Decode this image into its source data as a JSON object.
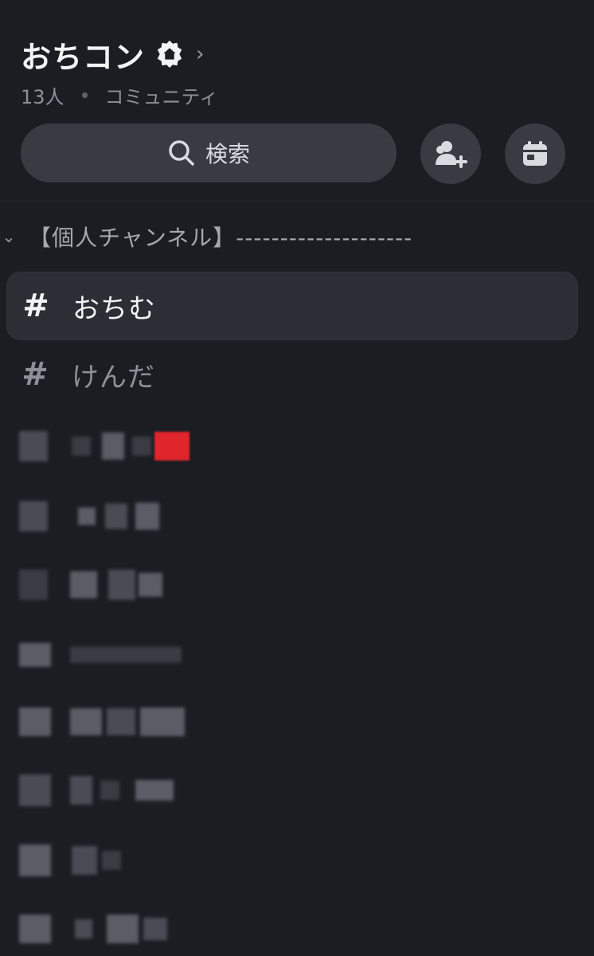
{
  "server": {
    "name": "おちコン",
    "member_count": "13人",
    "type_label": "コミュニティ"
  },
  "search": {
    "placeholder": "検索"
  },
  "icons": {
    "badge": "home-badge-icon",
    "chevron": "chevron-right-icon",
    "search": "search-icon",
    "invite": "add-member-icon",
    "events": "calendar-icon",
    "category_chevron": "chevron-down-icon",
    "channel": "hash-icon"
  },
  "category": {
    "label": "【個人チャンネル】--------------------"
  },
  "channels": [
    {
      "label": "おちむ",
      "active": true
    },
    {
      "label": "けんだ",
      "active": false
    }
  ],
  "colors": {
    "background": "#1c1d23",
    "surface": "#393b43",
    "active_row": "#2c2e35",
    "text_primary": "#f2f3f5",
    "text_muted": "#8d9098",
    "unread_red": "#e0262b"
  }
}
